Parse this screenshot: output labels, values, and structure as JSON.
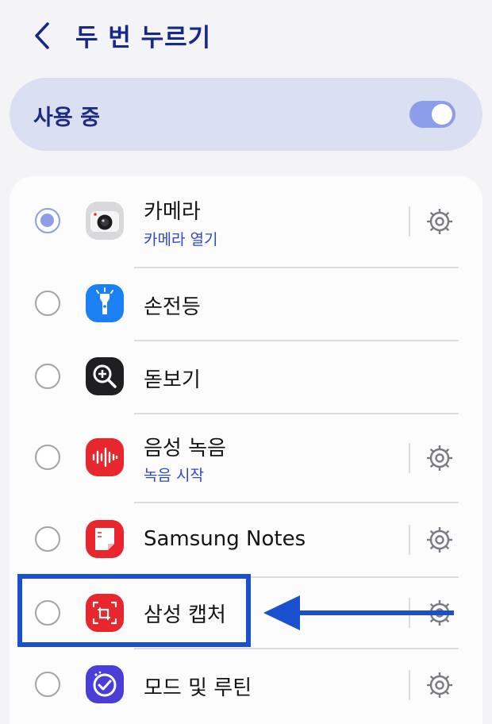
{
  "header": {
    "title": "두 번 누르기",
    "back_icon": "chevron-left-icon"
  },
  "master_switch": {
    "label": "사용 중",
    "state": "on"
  },
  "colors": {
    "title": "#16288a",
    "accent": "#8f9de8",
    "subtitle": "#2f48c9",
    "highlight": "#1a4fcf"
  },
  "options": [
    {
      "title": "카메라",
      "subtitle": "카메라 열기",
      "selected": true,
      "has_settings": true,
      "icon": "camera-icon"
    },
    {
      "title": "손전등",
      "subtitle": "",
      "selected": false,
      "has_settings": false,
      "icon": "flashlight-icon"
    },
    {
      "title": "돋보기",
      "subtitle": "",
      "selected": false,
      "has_settings": false,
      "icon": "magnifier-icon"
    },
    {
      "title": "음성 녹음",
      "subtitle": "녹음 시작",
      "selected": false,
      "has_settings": true,
      "icon": "voice-recorder-icon"
    },
    {
      "title": "Samsung Notes",
      "subtitle": "",
      "selected": false,
      "has_settings": true,
      "icon": "notes-icon"
    },
    {
      "title": "삼성 캡처",
      "subtitle": "",
      "selected": false,
      "has_settings": true,
      "icon": "capture-icon"
    },
    {
      "title": "모드 및 루틴",
      "subtitle": "",
      "selected": false,
      "has_settings": true,
      "icon": "modes-routines-icon"
    }
  ],
  "annotation": {
    "highlighted_option": "삼성 캡처",
    "arrow_icon": "left-arrow-icon"
  }
}
